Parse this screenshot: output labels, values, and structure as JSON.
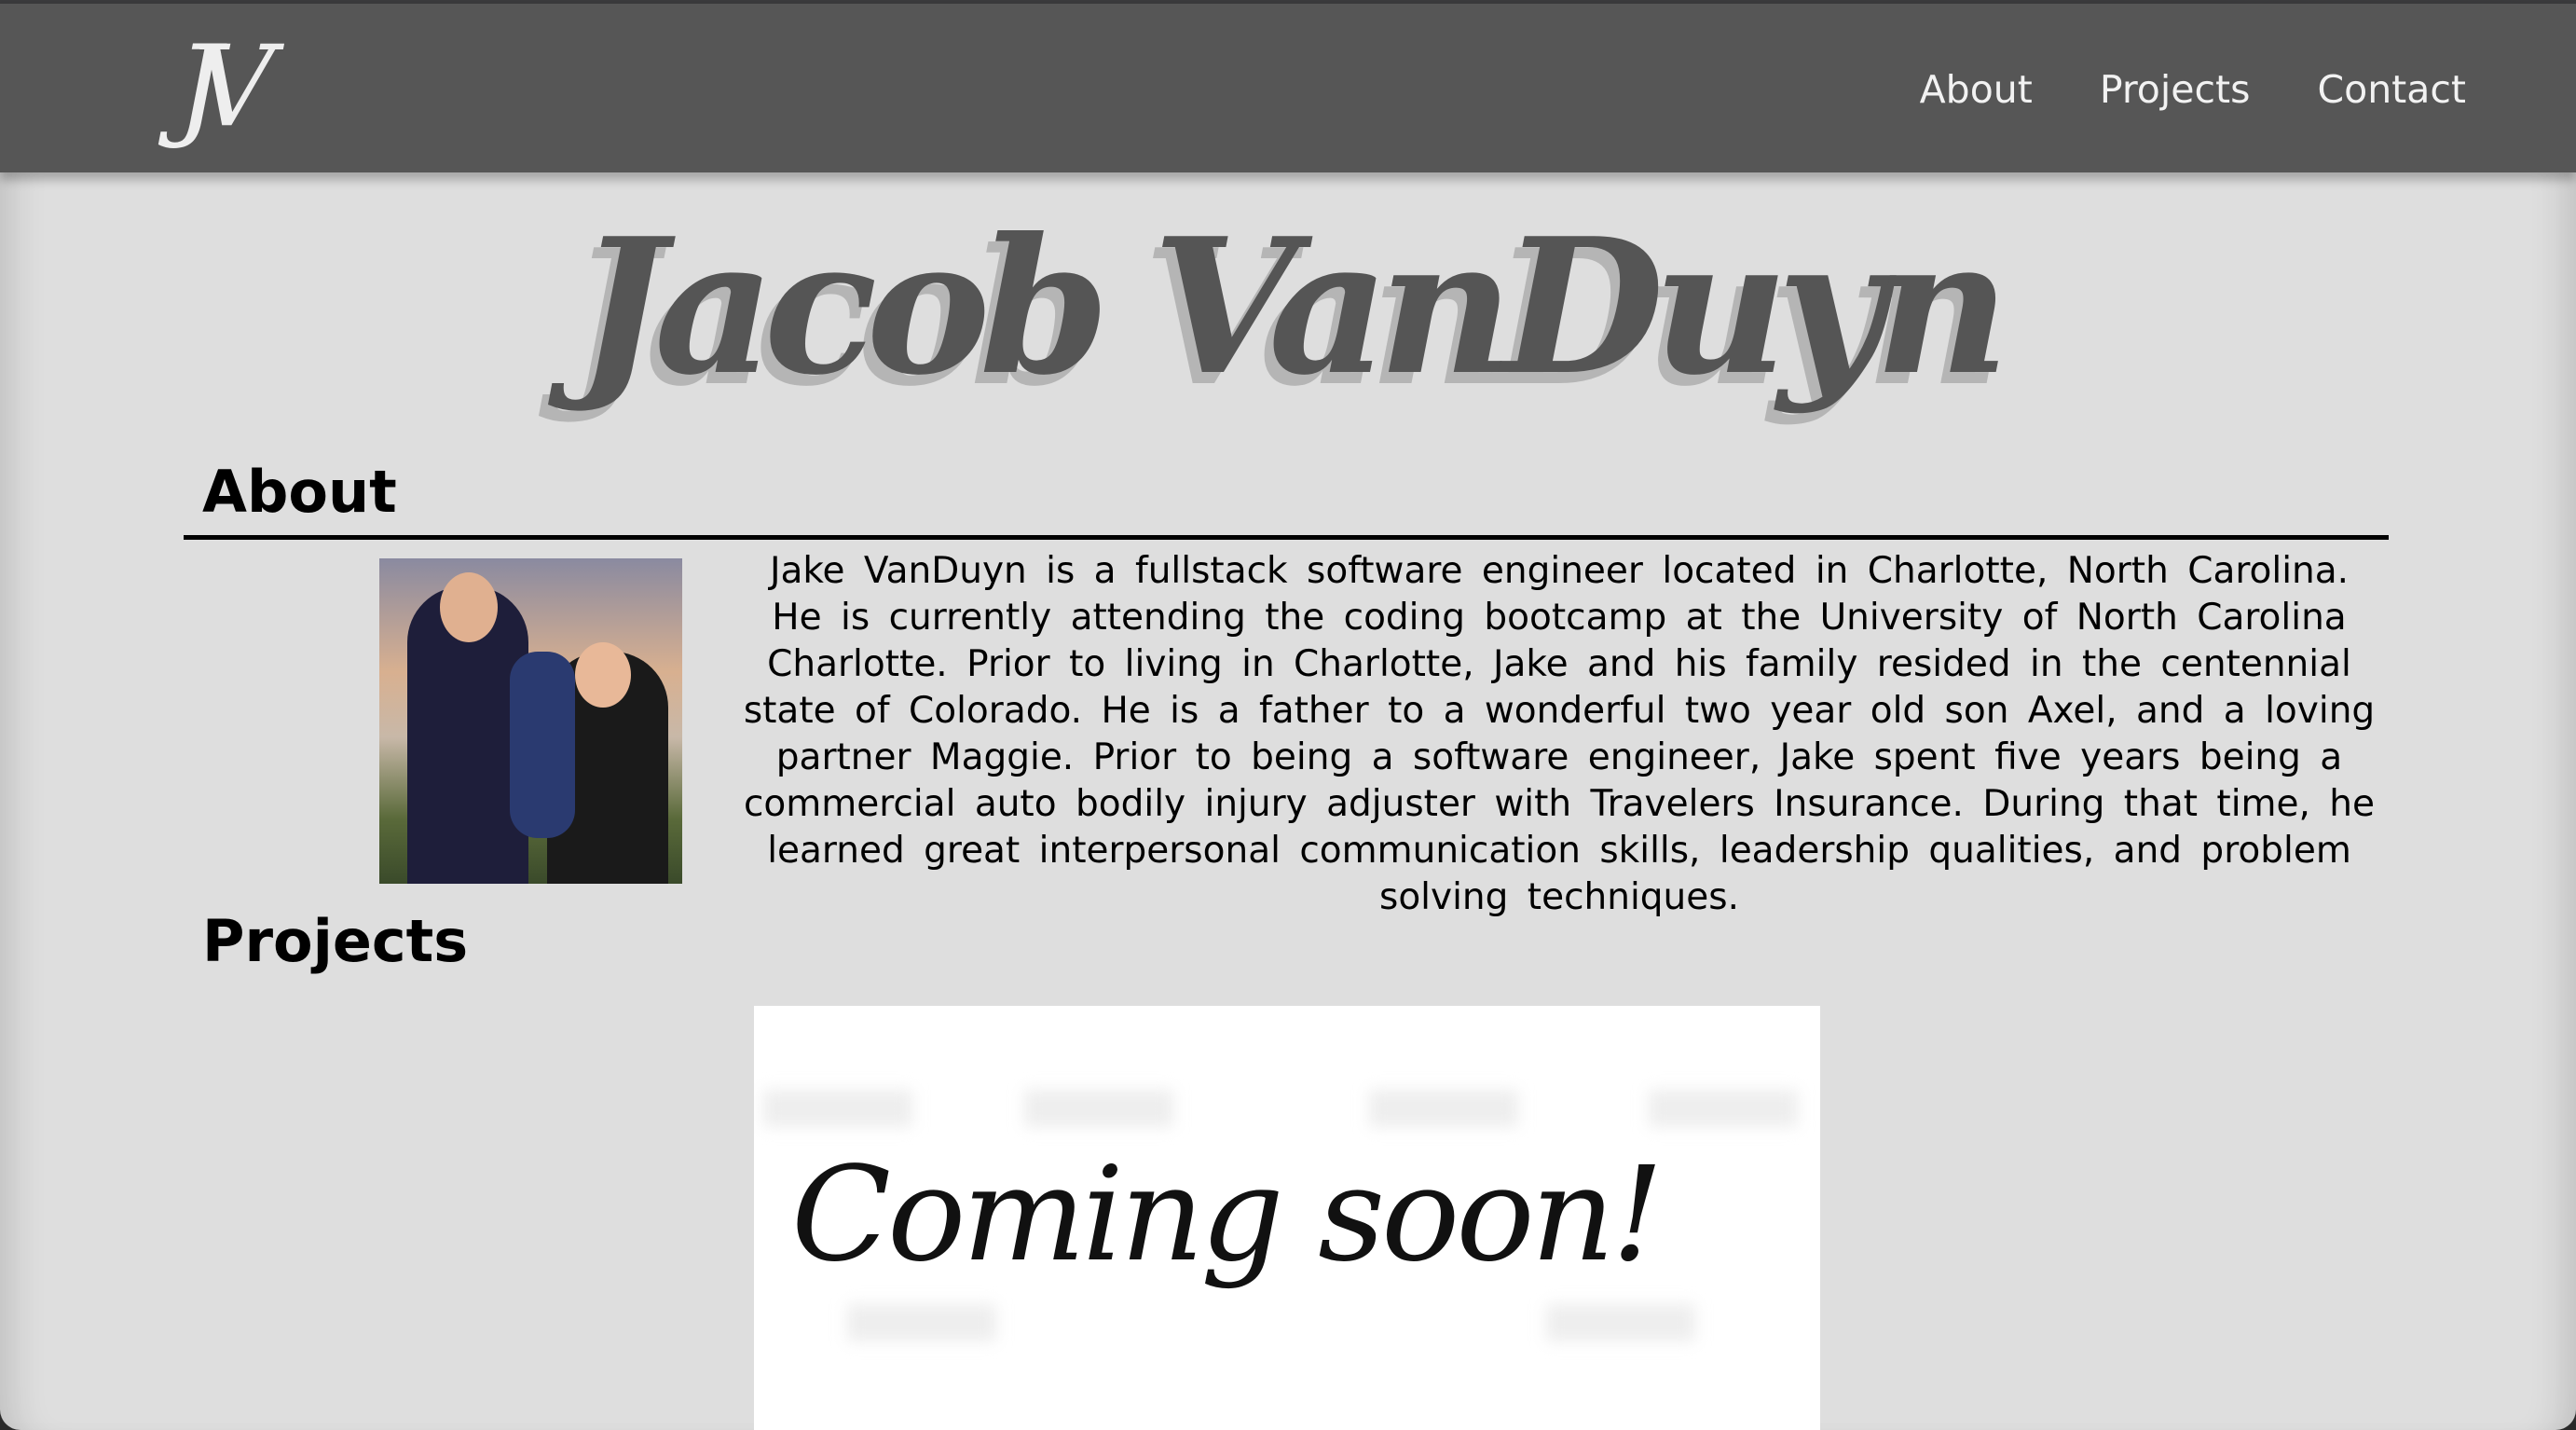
{
  "header": {
    "logo": "JV",
    "nav": [
      "About",
      "Projects",
      "Contact"
    ]
  },
  "title": "Jacob VanDuyn",
  "about": {
    "heading": "About",
    "text": "Jake VanDuyn is a fullstack software engineer located in Charlotte, North Carolina. He is currently attending the coding bootcamp at the University of North Carolina Charlotte. Prior to living in Charlotte, Jake and his family resided in the centennial state of Colorado. He is a father to a wonderful two year old son Axel, and a loving partner Maggie. Prior to being a software engineer, Jake spent five years being a commercial auto bodily injury adjuster with Travelers Insurance. During that time, he learned great interpersonal communication skills, leadership qualities, and problem solving techniques."
  },
  "projects": {
    "heading": "Projects",
    "image_text": "Coming soon!"
  }
}
